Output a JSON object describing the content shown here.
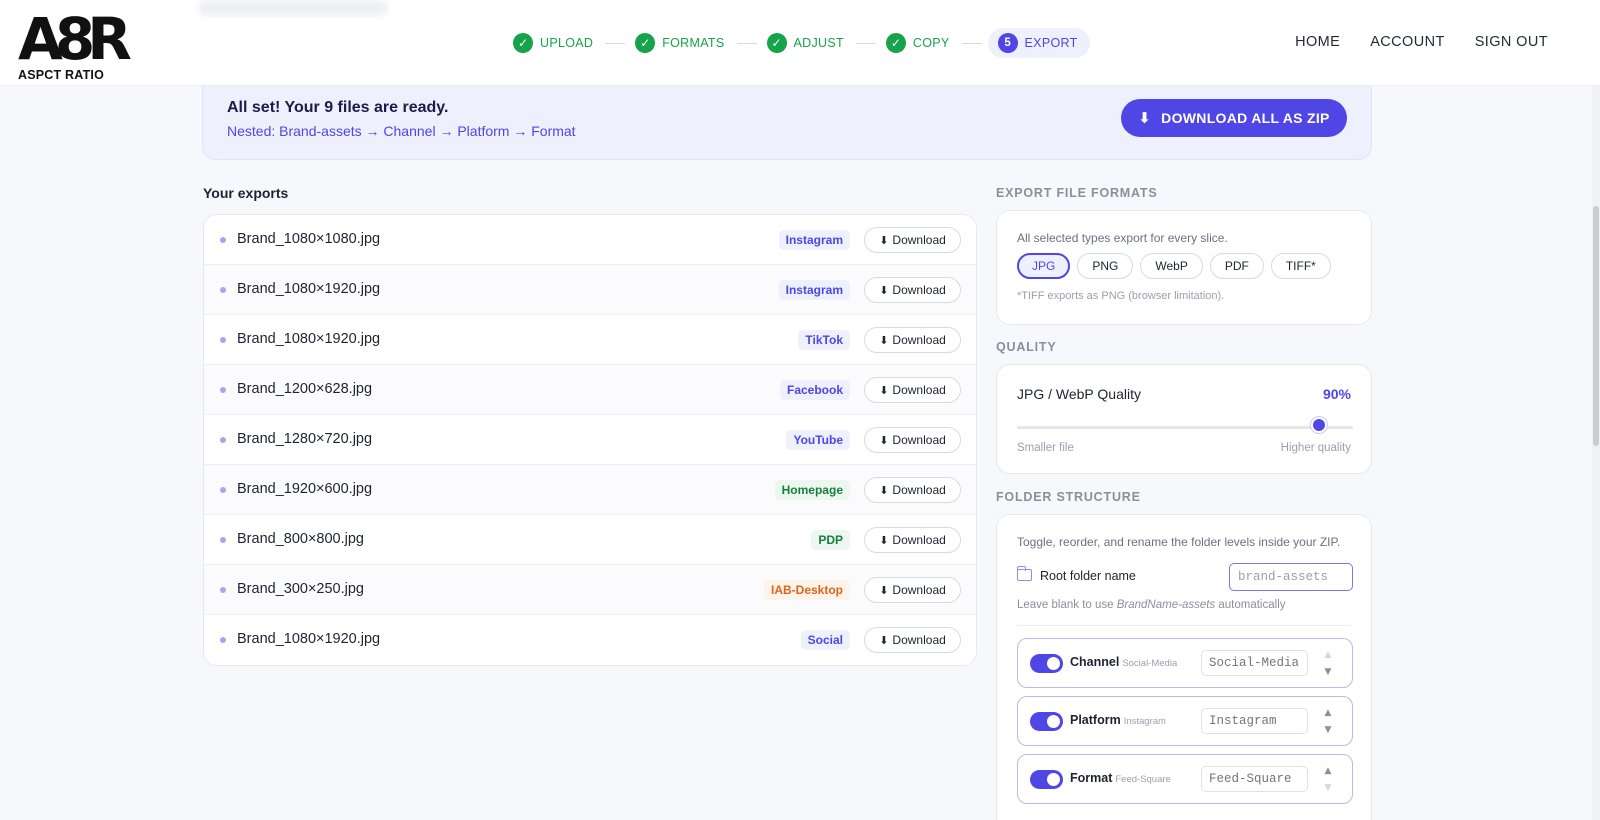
{
  "brand": {
    "logo_mark": "A8R",
    "logo_text": "ASPCT RATIO"
  },
  "steps": [
    {
      "label": "UPLOAD",
      "state": "done",
      "icon": "check-icon"
    },
    {
      "label": "FORMATS",
      "state": "done",
      "icon": "check-icon"
    },
    {
      "label": "ADJUST",
      "state": "done",
      "icon": "check-icon"
    },
    {
      "label": "COPY",
      "state": "done",
      "icon": "check-icon"
    },
    {
      "label": "EXPORT",
      "state": "active",
      "number": "5"
    }
  ],
  "nav": {
    "home": "HOME",
    "account": "ACCOUNT",
    "signout": "SIGN OUT"
  },
  "banner": {
    "title": "All set! Your 9 files are ready.",
    "subtitle": "Nested: Brand-assets → Channel → Platform → Format",
    "zip_button": "DOWNLOAD ALL AS ZIP"
  },
  "exports": {
    "title": "Your exports",
    "download_label": "Download",
    "files": [
      {
        "name": "Brand_1080×1080.jpg",
        "tag": "Instagram",
        "tone": "blue"
      },
      {
        "name": "Brand_1080×1920.jpg",
        "tag": "Instagram",
        "tone": "blue"
      },
      {
        "name": "Brand_1080×1920.jpg",
        "tag": "TikTok",
        "tone": "blue"
      },
      {
        "name": "Brand_1200×628.jpg",
        "tag": "Facebook",
        "tone": "blue"
      },
      {
        "name": "Brand_1280×720.jpg",
        "tag": "YouTube",
        "tone": "blue"
      },
      {
        "name": "Brand_1920×600.jpg",
        "tag": "Homepage",
        "tone": "green"
      },
      {
        "name": "Brand_800×800.jpg",
        "tag": "PDP",
        "tone": "green"
      },
      {
        "name": "Brand_300×250.jpg",
        "tag": "IAB-Desktop",
        "tone": "orange"
      },
      {
        "name": "Brand_1080×1920.jpg",
        "tag": "Social",
        "tone": "blue"
      }
    ]
  },
  "formats": {
    "label": "EXPORT FILE FORMATS",
    "description": "All selected types export for every slice.",
    "options": [
      "JPG",
      "PNG",
      "WebP",
      "PDF",
      "TIFF*"
    ],
    "selected": "JPG",
    "note": "*TIFF exports as PNG (browser limitation)."
  },
  "quality": {
    "label": "QUALITY",
    "title": "JPG / WebP Quality",
    "value_text": "90%",
    "value": 0.9,
    "low_label": "Smaller file",
    "high_label": "Higher quality"
  },
  "folders": {
    "label": "FOLDER STRUCTURE",
    "description": "Toggle, reorder, and rename the folder levels inside your ZIP.",
    "root_label": "Root folder name",
    "root_placeholder": "brand-assets",
    "hint_prefix": "Leave blank to use ",
    "hint_italic": "BrandName-assets",
    "hint_suffix": " automatically",
    "levels": [
      {
        "name": "Channel",
        "sub": "Social-Media",
        "placeholder": "Social-Media",
        "enabled": true
      },
      {
        "name": "Platform",
        "sub": "Instagram",
        "placeholder": "Instagram",
        "enabled": true
      },
      {
        "name": "Format",
        "sub": "Feed-Square",
        "placeholder": "Feed-Square",
        "enabled": true
      }
    ]
  },
  "colors": {
    "accent": "#4f46e5",
    "success": "#16a34a",
    "banner_bg": "#eef0fe"
  }
}
